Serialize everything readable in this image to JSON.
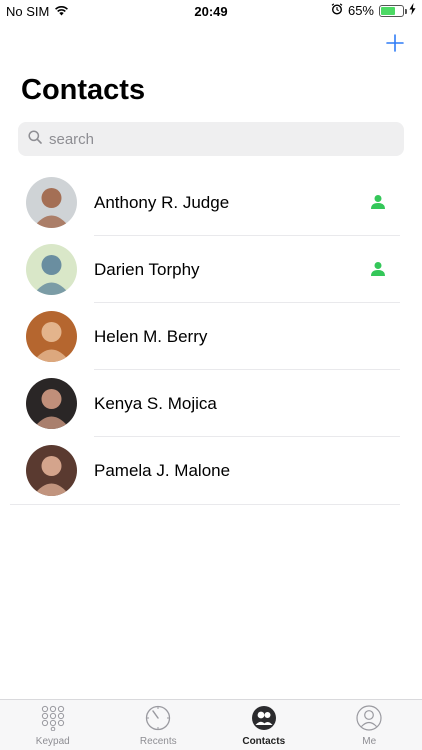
{
  "status_bar": {
    "carrier": "No SIM",
    "time": "20:49",
    "battery_percent": "65%",
    "battery_level": 0.65
  },
  "header": {
    "title": "Contacts"
  },
  "search": {
    "placeholder": "search"
  },
  "contacts": [
    {
      "name": "Anthony R. Judge",
      "has_badge": true,
      "avatar_colors": [
        "#cfd3d6",
        "#a46f55"
      ]
    },
    {
      "name": "Darien Torphy",
      "has_badge": true,
      "avatar_colors": [
        "#d9e7c8",
        "#6a8ea0"
      ]
    },
    {
      "name": "Helen M. Berry",
      "has_badge": false,
      "avatar_colors": [
        "#b5662f",
        "#e3b48c"
      ]
    },
    {
      "name": "Kenya S. Mojica",
      "has_badge": false,
      "avatar_colors": [
        "#2a2626",
        "#c08f7a"
      ]
    },
    {
      "name": "Pamela J. Malone",
      "has_badge": false,
      "avatar_colors": [
        "#5a3a30",
        "#d4a48c"
      ]
    }
  ],
  "tabs": [
    {
      "label": "Keypad",
      "icon": "keypad-icon",
      "active": false
    },
    {
      "label": "Recents",
      "icon": "clock-icon",
      "active": false
    },
    {
      "label": "Contacts",
      "icon": "contacts-icon",
      "active": true
    },
    {
      "label": "Me",
      "icon": "person-icon",
      "active": false
    }
  ],
  "colors": {
    "accent": "#2f7cf6",
    "badge": "#34c759",
    "battery": "#4cd964"
  }
}
